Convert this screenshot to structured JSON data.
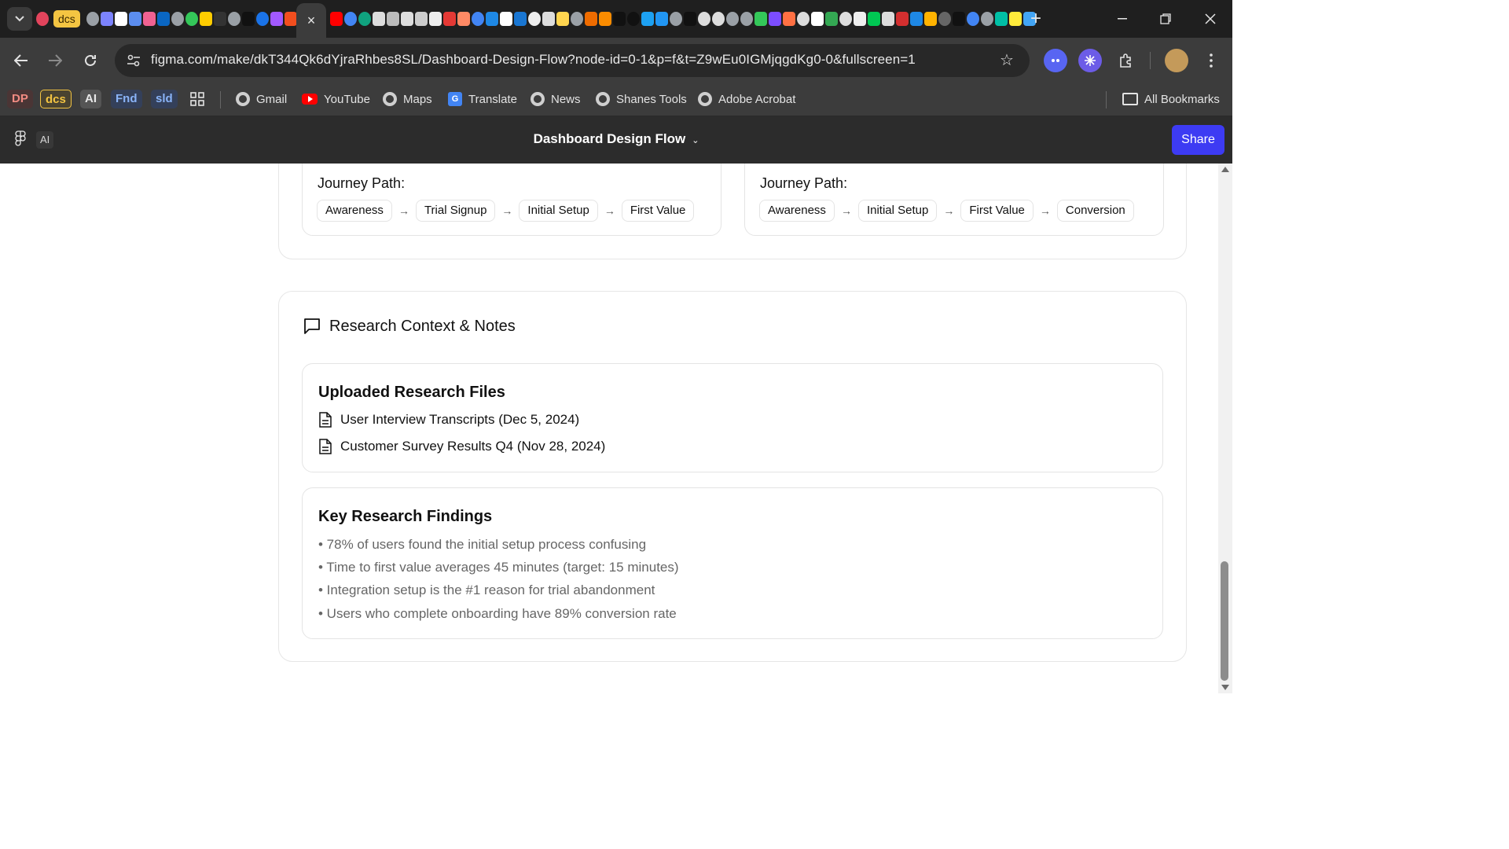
{
  "browser": {
    "pinned_chip": "dcs",
    "active_tab_close": "×",
    "new_tab": "+",
    "url": "figma.com/make/dkT344Qk6dYjraRhbes8SL/Dashboard-Design-Flow?node-id=0-1&p=f&t=Z9wEu0IGMjqgdKg0-0&fullscreen=1"
  },
  "bookmarks": {
    "chips": [
      {
        "label": "DP",
        "color": "#f28b82",
        "bg": "#4a3535"
      },
      {
        "label": "dcs",
        "color": "#f4c542",
        "bg": "#4a4330"
      },
      {
        "label": "AI",
        "color": "#e8e8e8",
        "bg": "#555555"
      },
      {
        "label": "Fnd",
        "color": "#8ab4f8",
        "bg": "#34405a"
      },
      {
        "label": "sld",
        "color": "#8ab4f8",
        "bg": "#34405a"
      }
    ],
    "links": [
      "Gmail",
      "YouTube",
      "Maps",
      "Translate",
      "News",
      "Shanes Tools",
      "Adobe Acrobat"
    ],
    "all_bookmarks": "All Bookmarks"
  },
  "figma": {
    "ai_label": "AI",
    "title": "Dashboard Design Flow",
    "share": "Share"
  },
  "journeys": [
    {
      "label": "Journey Path:",
      "steps": [
        "Awareness",
        "Trial Signup",
        "Initial Setup",
        "First Value"
      ]
    },
    {
      "label": "Journey Path:",
      "steps": [
        "Awareness",
        "Initial Setup",
        "First Value",
        "Conversion"
      ]
    }
  ],
  "research": {
    "section_title": "Research Context & Notes",
    "files_title": "Uploaded Research Files",
    "files": [
      "User Interview Transcripts (Dec 5, 2024)",
      "Customer Survey Results Q4 (Nov 28, 2024)"
    ],
    "findings_title": "Key Research Findings",
    "findings": [
      "• 78% of users found the initial setup process confusing",
      "• Time to first value averages 45 minutes (target: 15 minutes)",
      "• Integration setup is the #1 reason for trial abandonment",
      "• Users who complete onboarding have 89% conversion rate"
    ]
  },
  "colors": {
    "share_button": "#3d3bf3",
    "figma_header": "#2c2c2c",
    "browser_chrome": "#3c3c3c"
  }
}
